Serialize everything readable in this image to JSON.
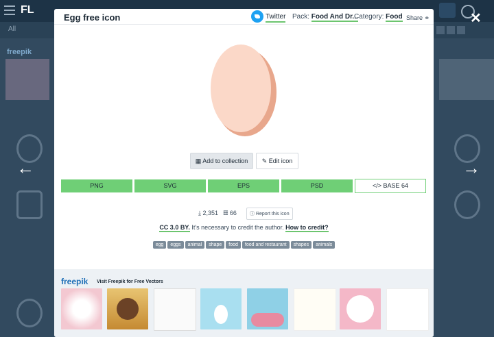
{
  "background": {
    "logo": "FL",
    "subbar_all": "All",
    "freepik": "freepik"
  },
  "modal": {
    "title": "Egg free icon",
    "twitter_label": "Twitter",
    "pack_label": "Pack:",
    "pack_value": "Food And Dr...",
    "category_label": "Category:",
    "category_value": "Food",
    "share_label": "Share",
    "add_collection_label": "Add to collection",
    "edit_icon_label": "Edit icon",
    "formats": [
      "PNG",
      "SVG",
      "EPS",
      "PSD"
    ],
    "base64_label": "</> BASE 64",
    "downloads": "2,351",
    "collections": "66",
    "report_label": "Report this icon",
    "license": "CC 3.0 BY.",
    "license_text": "It's necessary to credit the author.",
    "credit_link": "How to credit?",
    "tags": [
      "egg",
      "eggs",
      "animal",
      "shape",
      "food",
      "food and restaurant",
      "shapes",
      "animals"
    ],
    "footer_logo": "freepik",
    "footer_visit": "Visit Freepik for Free Vectors"
  },
  "colors": {
    "green": "#6fcf76",
    "egg_light": "#fbd8c8",
    "egg_shadow": "#e8a78c",
    "twitter": "#1da1f2"
  },
  "icons": [
    "close-icon",
    "arrow-left-icon",
    "arrow-right-icon",
    "twitter-icon",
    "share-icon",
    "collection-icon",
    "edit-icon",
    "download-icon",
    "collection-count-icon",
    "report-icon"
  ]
}
